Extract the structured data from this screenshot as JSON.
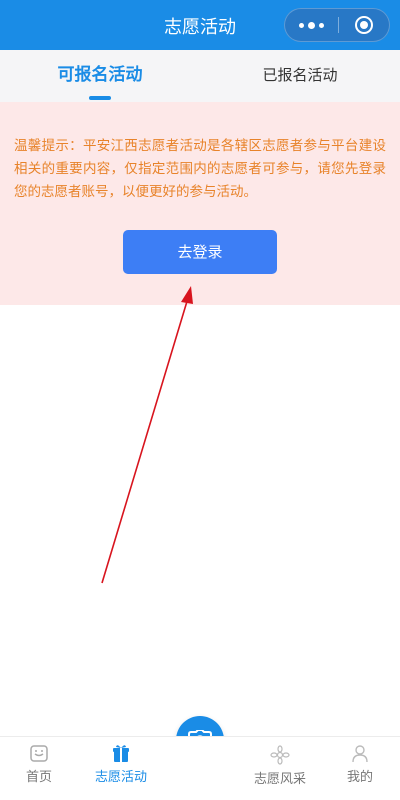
{
  "header": {
    "title": "志愿活动",
    "menu_icon": "more-dots-icon",
    "close_icon": "target-icon"
  },
  "tabs": [
    {
      "label": "可报名活动",
      "active": true
    },
    {
      "label": "已报名活动",
      "active": false
    }
  ],
  "notice": {
    "text": "温馨提示：平安江西志愿者活动是各辖区志愿者参与平台建设相关的重要内容，仅指定范围内的志愿者可参与，请您先登录您的志愿者账号，以便更好的参与活动。",
    "button_label": "去登录"
  },
  "bottom_nav": {
    "items": [
      {
        "label": "首页",
        "icon": "home-icon",
        "active": false
      },
      {
        "label": "志愿活动",
        "icon": "gift-icon",
        "active": true
      },
      {
        "label": "志愿风采",
        "icon": "flower-icon",
        "active": false
      },
      {
        "label": "我的",
        "icon": "user-icon",
        "active": false
      }
    ],
    "center_icon": "camera-icon"
  },
  "colors": {
    "primary": "#1a8ce6",
    "button": "#3d7ef5",
    "notice_bg": "#fde8e8",
    "notice_text": "#e8832a",
    "annotation": "#d8141e"
  }
}
